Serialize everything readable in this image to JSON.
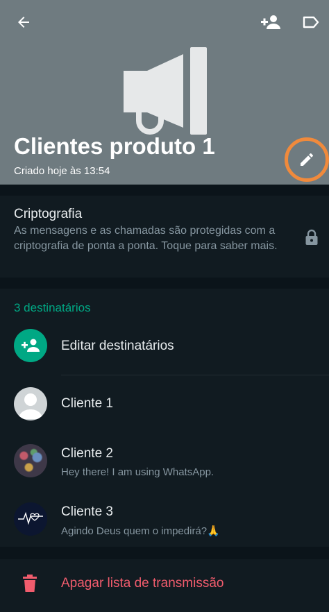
{
  "header": {
    "title": "Clientes produto 1",
    "subtitle": "Criado hoje às 13:54",
    "icons": [
      "back-arrow-icon",
      "add-person-icon",
      "label-icon",
      "megaphone-icon",
      "pencil-icon"
    ],
    "background_color": "#6f7b80",
    "highlight_color": "#f08a3c"
  },
  "encryption": {
    "title": "Criptografia",
    "description": "As mensagens e as chamadas são protegidas com a criptografia de ponta a ponta. Toque para saber mais."
  },
  "recipients": {
    "count_label": "3 destinatários",
    "edit_label": "Editar destinatários",
    "accent_color": "#00a884",
    "items": [
      {
        "name": "Cliente 1",
        "status": ""
      },
      {
        "name": "Cliente 2",
        "status": "Hey there! I am using WhatsApp."
      },
      {
        "name": "Cliente 3",
        "status": "Agindo Deus quem o impedirá?🙏"
      }
    ]
  },
  "delete": {
    "label": "Apagar lista de transmissão",
    "color": "#f15c6d"
  }
}
